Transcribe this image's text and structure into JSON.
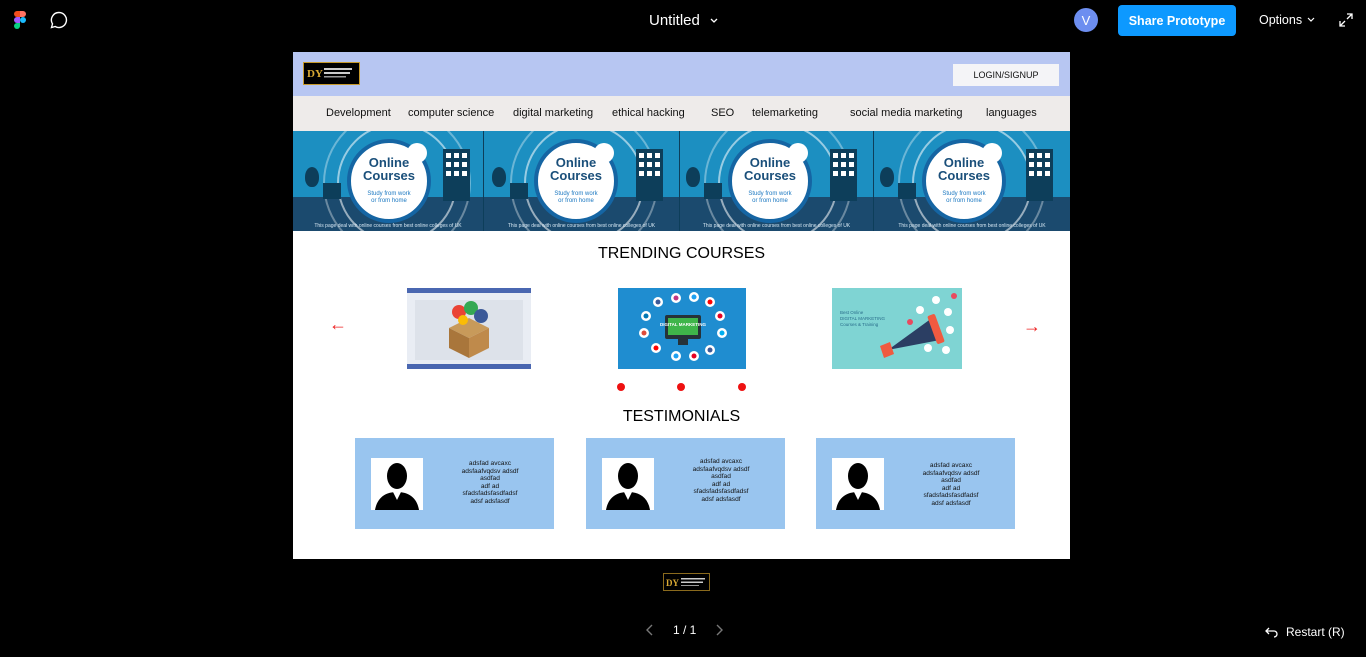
{
  "toolbar": {
    "file_title": "Untitled",
    "avatar_initial": "V",
    "share_label": "Share Prototype",
    "options_label": "Options",
    "icons": [
      "figma-logo-icon",
      "comment-icon",
      "chevron-down-icon",
      "expand-icon"
    ]
  },
  "site": {
    "login_label": "LOGIN/SIGNUP",
    "nav": [
      "Development",
      "computer science",
      "digital marketing",
      "ethical hacking",
      "SEO",
      "telemarketing",
      "social media marketing",
      "languages"
    ],
    "banner": {
      "heading_line1": "Online",
      "heading_line2": "Courses",
      "sub_line1": "Study from work",
      "sub_line2": "or from home",
      "footer": "This page deal with online courses from best online colleges of UK",
      "tile_count": 4
    },
    "trending_title": "TRENDING COURSES",
    "prev_arrow": "←",
    "next_arrow": "→",
    "courses": [
      {
        "name": "course-card-seo",
        "caption": ""
      },
      {
        "name": "course-card-digital-marketing",
        "caption": "DIGITAL MARKETING"
      },
      {
        "name": "course-card-digital-marketing-training",
        "caption_lines": [
          "Best Online",
          "DIGITAL MARKETING",
          "Courses & Training"
        ]
      }
    ],
    "testimonials_title": "TESTIMONIALS",
    "testimonials": [
      {
        "text": "adsfad avcaxc\nadsfaafvqdsv adsdf\nasdfad\nadf ad\nsfadsfadsfasdfadsf\nadsf adsfasdf"
      },
      {
        "text": "adsfad avcaxc\nadsfaafvqdsv adsdf\nasdfad\nadf ad\nsfadsfadsfasdfadsf\nadsf adsfasdf"
      },
      {
        "text": "adsfad avcaxc\nadsfaafvqdsv adsdf\nasdfad\nadf ad\nsfadsfadsfasdfadsf\nadsf adsfasdf"
      }
    ]
  },
  "bottom": {
    "page_indicator": "1 / 1",
    "restart_label": "Restart (R)"
  },
  "colors": {
    "primary_button": "#0d99ff",
    "header_bg": "#b7c6f2",
    "testimonial_bg": "#99c5ef",
    "carousel_dot": "#e11111"
  }
}
